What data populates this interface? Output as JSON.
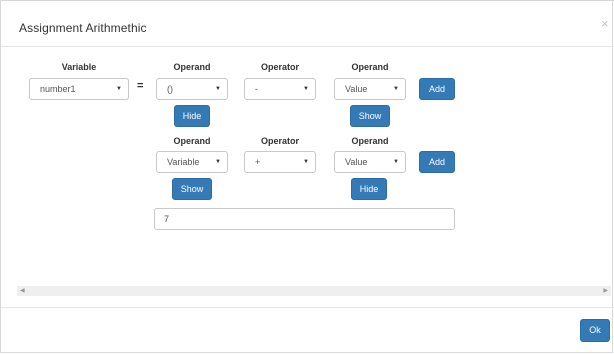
{
  "dialog": {
    "title": "Assignment Arithmethic",
    "close_symbol": "×"
  },
  "labels": {
    "variable": "Variable",
    "operand": "Operand",
    "operator": "Operator",
    "equals": "="
  },
  "row1": {
    "variable_value": "number1",
    "operand1_value": "()",
    "operator_value": "-",
    "operand2_value": "Value",
    "add_label": "Add",
    "hide_label": "Hide",
    "show_label": "Show"
  },
  "row2": {
    "operand1_value": "Variable",
    "operator_value": "+",
    "operand2_value": "Value",
    "add_label": "Add",
    "show_label": "Show",
    "hide_label": "Hide"
  },
  "value_input": "7",
  "footer": {
    "ok_label": "Ok"
  },
  "icons": {
    "caret": "▼",
    "scroll_left": "◀",
    "scroll_right": "▶"
  },
  "colors": {
    "primary": "#337ab7",
    "border": "#c9c9c9"
  }
}
